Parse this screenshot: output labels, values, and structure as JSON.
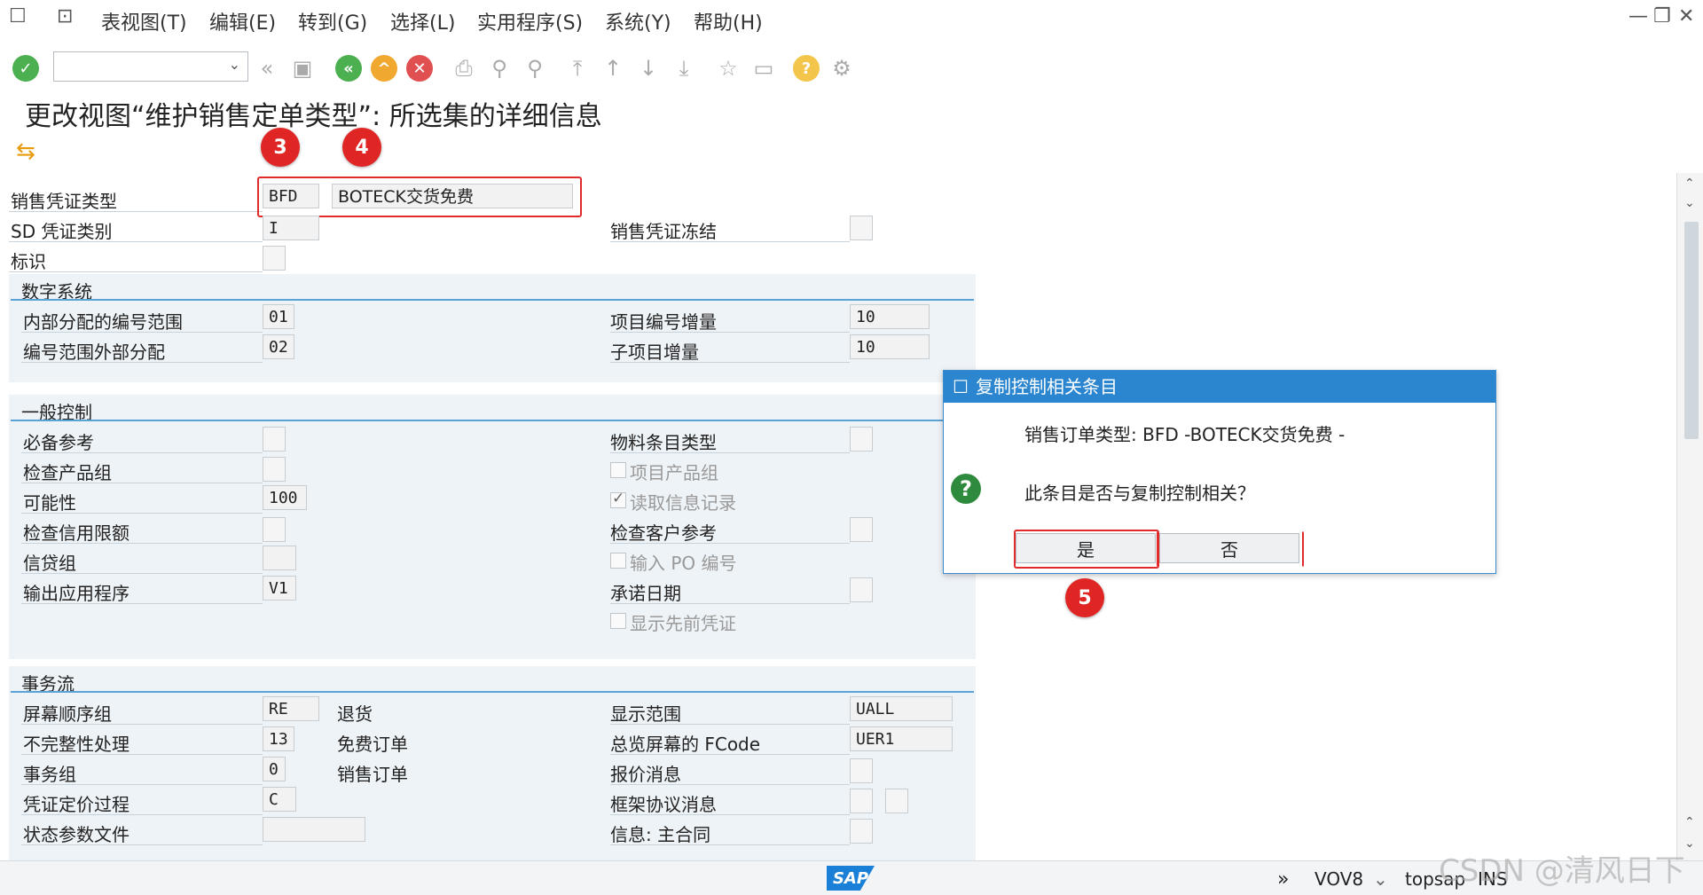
{
  "menu": {
    "items": [
      "表视图(T)",
      "编辑(E)",
      "转到(G)",
      "选择(L)",
      "实用程序(S)",
      "系统(Y)",
      "帮助(H)"
    ]
  },
  "title": "更改视图“维护销售定单类型”: 所选集的详细信息",
  "header_fields": {
    "doc_type_label": "销售凭证类型",
    "doc_type_code": "BFD",
    "doc_type_desc": "BOTECK交货免费",
    "sd_category_label": "SD 凭证类别",
    "sd_category_value": "I",
    "block_label": "销售凭证冻结",
    "indicator_label": "标识"
  },
  "number_system": {
    "header": "数字系统",
    "internal_range_label": "内部分配的编号范围",
    "internal_range_value": "01",
    "external_range_label": "编号范围外部分配",
    "external_range_value": "02",
    "item_incr_label": "项目编号增量",
    "item_incr_value": "10",
    "subitem_incr_label": "子项目增量",
    "subitem_incr_value": "10"
  },
  "general_control": {
    "header": "一般控制",
    "ref_mandatory": "必备参考",
    "check_div": "检查产品组",
    "probability": "可能性",
    "probability_value": "100",
    "check_credit": "检查信用限额",
    "credit_group": "信贷组",
    "output_app": "输出应用程序",
    "output_app_value": "V1",
    "mat_entry_type": "物料条目类型",
    "item_div": "项目产品组",
    "read_info_rec": "读取信息记录",
    "check_cust_ref": "检查客户参考",
    "enter_po": "输入 PO 编号",
    "commit_date": "承诺日期",
    "show_prev_doc": "显示先前凭证"
  },
  "transaction_flow": {
    "header": "事务流",
    "screen_seq": "屏幕顺序组",
    "screen_seq_value": "RE",
    "screen_seq_desc": "退货",
    "incompletion": "不完整性处理",
    "incompletion_value": "13",
    "incompletion_desc": "免费订单",
    "trans_group": "事务组",
    "trans_group_value": "0",
    "trans_group_desc": "销售订单",
    "pricing_proc": "凭证定价过程",
    "pricing_proc_value": "C",
    "status_profile": "状态参数文件",
    "display_range": "显示范围",
    "display_range_value": "UALL",
    "fcode_label": "总览屏幕的 FCode",
    "fcode_value": "UER1",
    "quote_msg": "报价消息",
    "contract_msg": "框架协议消息",
    "info_contract": "信息: 主合同"
  },
  "dialog": {
    "title": "复制控制相关条目",
    "line1": "销售订单类型: BFD -BOTECK交货免费 -",
    "line2": "此条目是否与复制控制相关？",
    "yes": "是",
    "no": "否"
  },
  "badges": [
    "3",
    "4",
    "5"
  ],
  "status": {
    "transaction": "VOV8",
    "system": "topsap",
    "mode": "INS",
    "sap_logo": "SAP"
  },
  "watermark": "CSDN @清风日下",
  "colors": {
    "accent": "#2b86cf",
    "annotation_red": "#e02525",
    "group_line": "#5aa3d6"
  }
}
